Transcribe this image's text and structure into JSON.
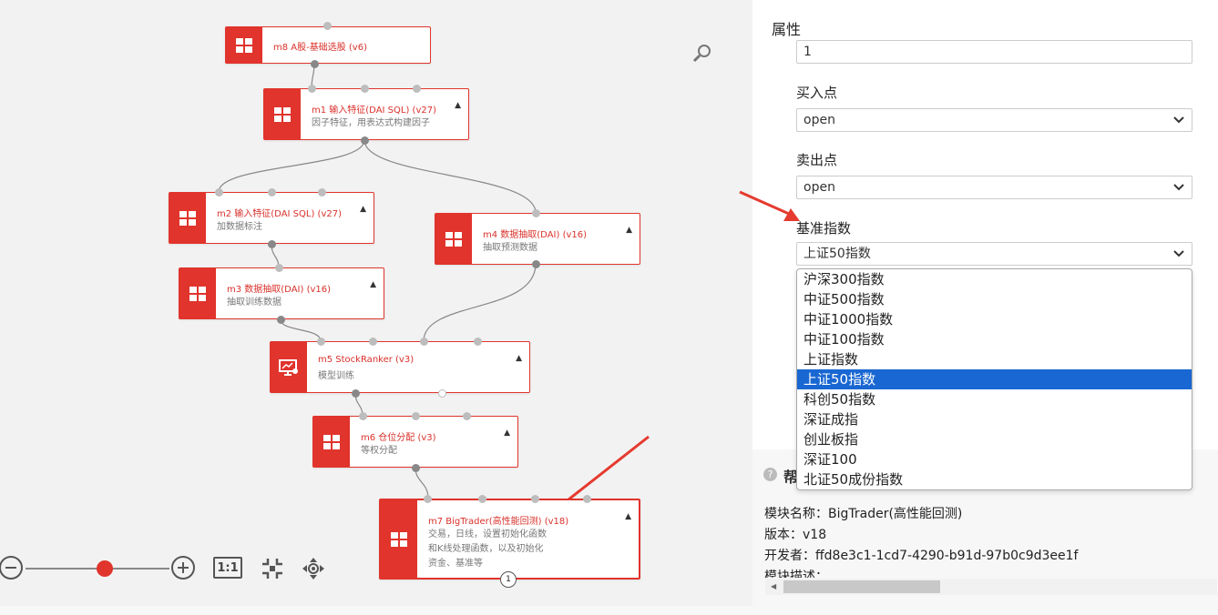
{
  "canvas": {
    "nodes": [
      {
        "id": "m8",
        "title": "m8 A股-基础选股 (v6)",
        "lines": [],
        "icon": "grid-icon"
      },
      {
        "id": "m1",
        "title": "m1 输入特征(DAI SQL) (v27)",
        "lines": [
          "因子特征，用表达式构建因子"
        ],
        "icon": "grid-icon"
      },
      {
        "id": "m2",
        "title": "m2 输入特征(DAI SQL) (v27)",
        "lines": [
          "加数据标注"
        ],
        "icon": "grid-icon"
      },
      {
        "id": "m4",
        "title": "m4 数据抽取(DAI) (v16)",
        "lines": [
          "抽取预测数据"
        ],
        "icon": "grid-icon"
      },
      {
        "id": "m3",
        "title": "m3 数据抽取(DAI) (v16)",
        "lines": [
          "抽取训练数据"
        ],
        "icon": "grid-icon"
      },
      {
        "id": "m5",
        "title": "m5 StockRanker (v3)",
        "lines": [
          "模型训练"
        ],
        "icon": "chart-board-icon"
      },
      {
        "id": "m6",
        "title": "m6 仓位分配 (v3)",
        "lines": [
          "等权分配"
        ],
        "icon": "grid-icon"
      },
      {
        "id": "m7",
        "title": "m7 BigTrader(高性能回测) (v18)",
        "lines": [
          "交易，日线，设置初始化函数",
          "和K线处理函数，以及初始化",
          "资金、基准等"
        ],
        "icon": "grid-icon"
      }
    ],
    "m7_badge": "1",
    "zoom": {
      "fit_label": "1:1",
      "level": 0.55
    }
  },
  "panel": {
    "section_title": "属性",
    "first_value": "1",
    "buy_label": "买入点",
    "buy_value": "open",
    "sell_label": "卖出点",
    "sell_value": "open",
    "benchmark_label": "基准指数",
    "benchmark_value": "上证50指数",
    "benchmark_options": [
      "沪深300指数",
      "中证500指数",
      "中证1000指数",
      "中证100指数",
      "上证指数",
      "上证50指数",
      "科创50指数",
      "深证成指",
      "创业板指",
      "深证100",
      "北证50成份指数"
    ],
    "benchmark_selected_index": 5,
    "help": {
      "title": "帮",
      "name_line": "模块名称：BigTrader(高性能回测)",
      "version_line": "版本：v18",
      "developer_line": "开发者：ffd8e3c1-1cd7-4290-b91d-97b0c9d3ee1f",
      "desc_line": "模块描述："
    }
  },
  "colors": {
    "accent": "#e0342c",
    "selected": "#1967d2",
    "arrow": "#e53a2f"
  }
}
